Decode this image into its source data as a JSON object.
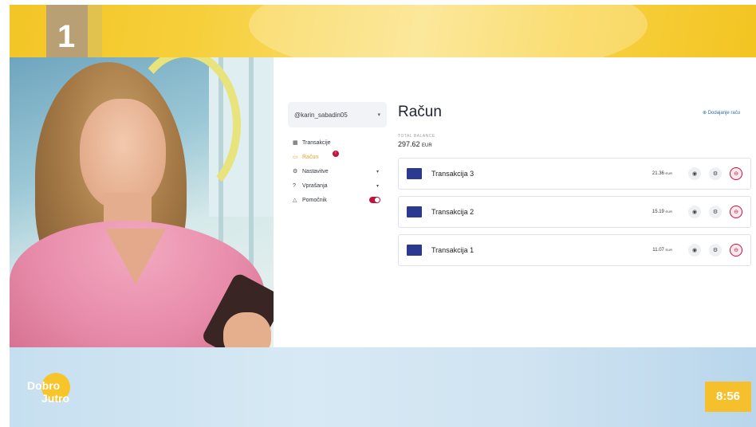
{
  "broadcast": {
    "channel_mark": "1",
    "show_logo_line1": "Dobro",
    "show_logo_line2": "Jutro",
    "clock": "8:56"
  },
  "account": {
    "username": "@karin_sabadin05"
  },
  "sidebar": {
    "items": [
      {
        "label": "Transakcije",
        "icon": "transactions-icon"
      },
      {
        "label": "Račun",
        "icon": "account-icon",
        "active": true,
        "badge": "!"
      },
      {
        "label": "Nastavitve",
        "icon": "settings-icon",
        "dropdown": true
      },
      {
        "label": "Vprašanja",
        "icon": "question-icon",
        "dropdown": true
      },
      {
        "label": "Pomočnik",
        "icon": "assistant-icon",
        "toggle": true
      }
    ]
  },
  "main": {
    "title": "Račun",
    "add_link": "Dodajanje raču",
    "balance_label": "TOTAL BALANCE",
    "balance_value": "297.62",
    "balance_currency": "EUR"
  },
  "transactions": [
    {
      "name": "Transakcija 3",
      "amount": "21.36",
      "currency": "EUR"
    },
    {
      "name": "Transakcija 2",
      "amount": "15.19",
      "currency": "EUR"
    },
    {
      "name": "Transakcija 1",
      "amount": "11.07",
      "currency": "EUR"
    }
  ],
  "colors": {
    "accent_red": "#c2133c",
    "active_orange": "#e7a21f",
    "flag_blue": "#2b3a8f",
    "banner_yellow": "#f3c526"
  }
}
